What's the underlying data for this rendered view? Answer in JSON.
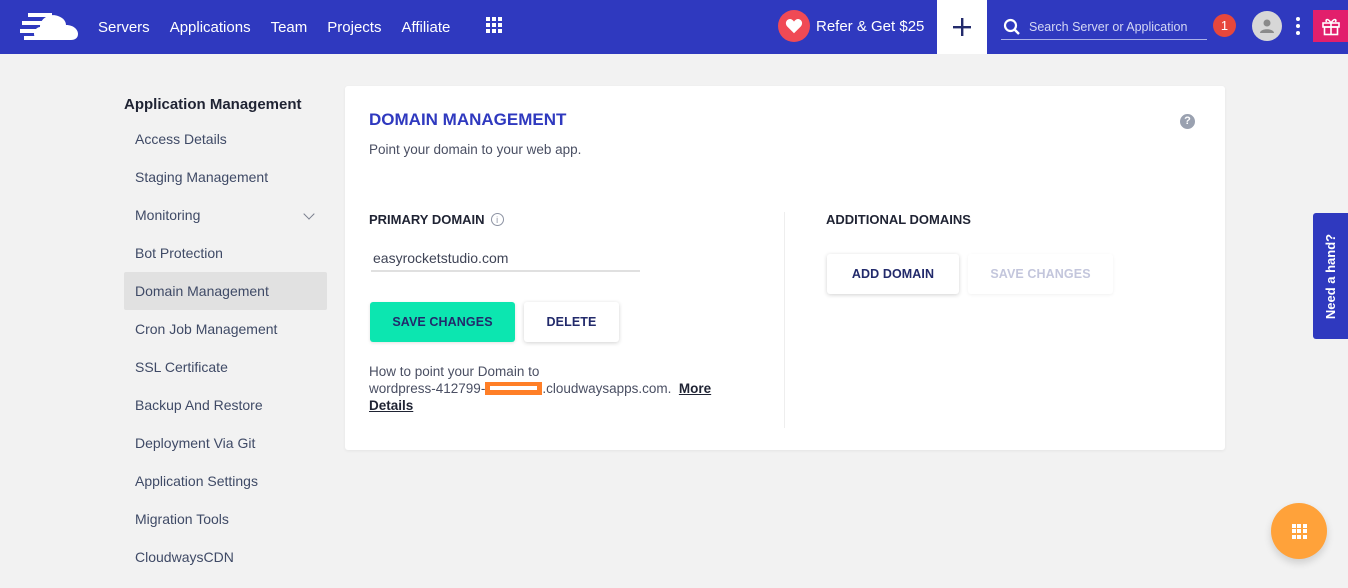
{
  "topbar": {
    "brand_color": "#2f39bf",
    "nav": [
      "Servers",
      "Applications",
      "Team",
      "Projects",
      "Affiliate"
    ],
    "refer_label": "Refer & Get $25",
    "search_placeholder": "Search Server or Application",
    "notification_count": "1"
  },
  "sidebar": {
    "title": "Application Management",
    "items": [
      {
        "label": "Access Details"
      },
      {
        "label": "Staging Management"
      },
      {
        "label": "Monitoring"
      },
      {
        "label": "Bot Protection"
      },
      {
        "label": "Domain Management"
      },
      {
        "label": "Cron Job Management"
      },
      {
        "label": "SSL Certificate"
      },
      {
        "label": "Backup And Restore"
      },
      {
        "label": "Deployment Via Git"
      },
      {
        "label": "Application Settings"
      },
      {
        "label": "Migration Tools"
      },
      {
        "label": "CloudwaysCDN"
      }
    ],
    "active_item": "Domain Management"
  },
  "card": {
    "title": "DOMAIN MANAGEMENT",
    "subtitle": "Point your domain to your web app.",
    "help_icon": "?",
    "primary": {
      "label": "PRIMARY DOMAIN",
      "info_icon": "i",
      "value": "easyrocketstudio.com",
      "save_label": "SAVE CHANGES",
      "delete_label": "DELETE",
      "howto_line1": "How to point your Domain to",
      "howto_prefix": "wordpress-412799-",
      "howto_suffix": ".cloudwaysapps.com.",
      "more_details": "More Details"
    },
    "additional": {
      "label": "ADDITIONAL DOMAINS",
      "add_label": "ADD DOMAIN",
      "save_label": "SAVE CHANGES"
    }
  },
  "need_hand": "Need a hand?",
  "colors": {
    "accent": "#2f39bf",
    "save_green": "#0ce6b0",
    "fab_orange": "#ffa23a",
    "gift_pink": "#e21f6c",
    "notif_red": "#e7473c"
  }
}
